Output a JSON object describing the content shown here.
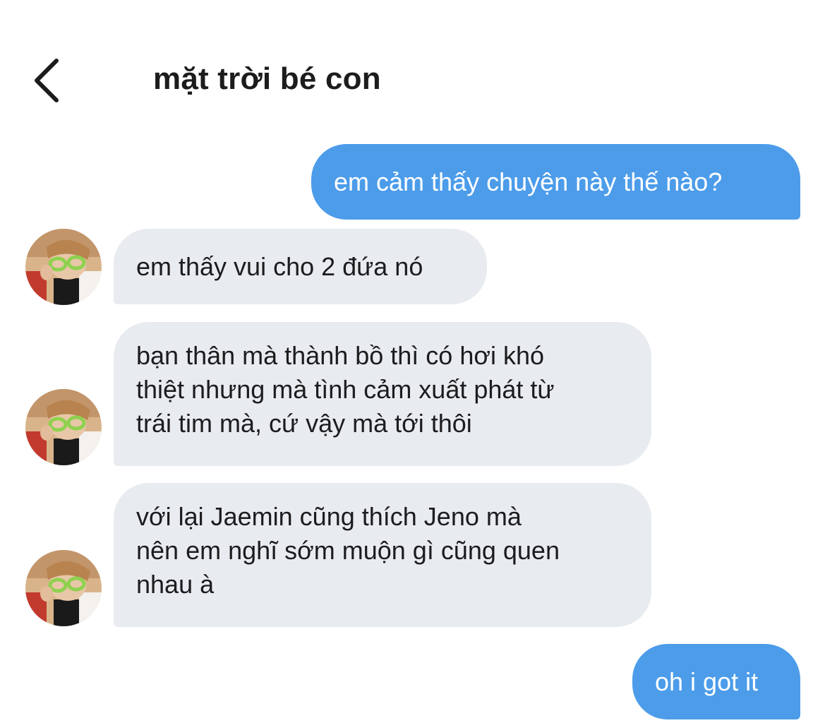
{
  "header": {
    "title": "mặt trời bé con",
    "back_icon": "chevron-left-icon"
  },
  "colors": {
    "outgoing_bubble": "#4c9cea",
    "incoming_bubble": "#e8ebef",
    "text_dark": "#1c1c1e",
    "text_light": "#ffffff"
  },
  "messages": [
    {
      "direction": "outgoing",
      "lines": [
        "em cảm thấy chuyện này thế nào?"
      ]
    },
    {
      "direction": "incoming",
      "lines": [
        "em thấy vui cho 2 đứa nó"
      ]
    },
    {
      "direction": "incoming",
      "lines": [
        "bạn thân mà thành bồ thì có hơi khó",
        "thiệt nhưng mà tình cảm xuất phát từ",
        "trái tim mà, cứ vậy mà tới thôi"
      ]
    },
    {
      "direction": "incoming",
      "lines": [
        "với lại Jaemin cũng thích Jeno mà",
        "nên em nghĩ sớm muộn gì cũng quen",
        "nhau à"
      ]
    },
    {
      "direction": "outgoing",
      "lines": [
        "oh i got it"
      ]
    }
  ]
}
